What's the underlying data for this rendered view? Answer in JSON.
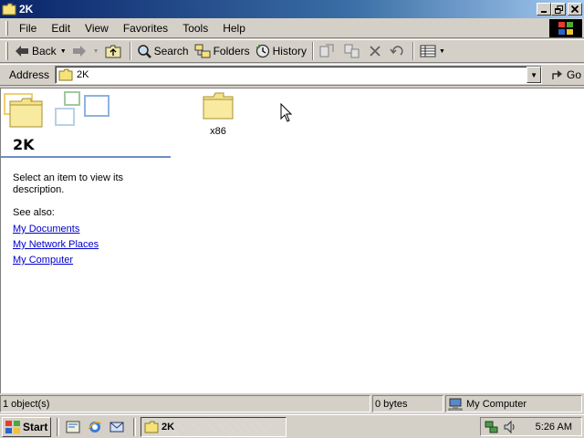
{
  "window": {
    "title": "2K"
  },
  "menu": {
    "items": [
      "File",
      "Edit",
      "View",
      "Favorites",
      "Tools",
      "Help"
    ]
  },
  "toolbar": {
    "back": "Back",
    "search": "Search",
    "folders": "Folders",
    "history": "History"
  },
  "address": {
    "label": "Address",
    "value": "2K",
    "go": "Go"
  },
  "leftpane": {
    "title": "2K",
    "description": "Select an item to view its description.",
    "see_also": "See also:",
    "links": [
      "My Documents",
      "My Network Places",
      "My Computer"
    ]
  },
  "files": [
    {
      "name": "x86",
      "icon": "folder-icon"
    }
  ],
  "status": {
    "objects": "1 object(s)",
    "size": "0 bytes",
    "zone": "My Computer"
  },
  "taskbar": {
    "start": "Start",
    "task": "2K",
    "clock": "5:26 AM"
  },
  "colors": {
    "titlebar": "#0a246a",
    "link": "#0000cc",
    "face": "#d4d0c8"
  }
}
